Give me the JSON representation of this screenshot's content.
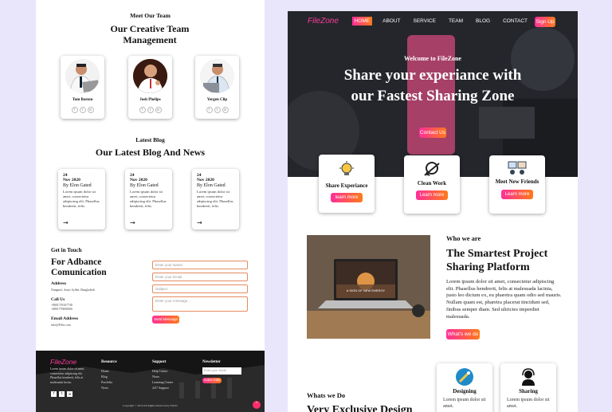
{
  "left": {
    "team_sub": "Meet Our Team",
    "team_title": "Our Creative Team Management",
    "members": [
      {
        "name": "Tom Baston"
      },
      {
        "name": "Josh Phelips"
      },
      {
        "name": "Yergen Clip"
      }
    ],
    "blog_sub": "Latest Blog",
    "blog_title": "Our Latest Blog And News",
    "posts": [
      {
        "day": "24",
        "month": "Nov 2020",
        "by": "By Elon Gated",
        "text": "Lorem ipsum dolor sit amet, consectetur adipiscing elit. Phasellus hendrerit, felis."
      },
      {
        "day": "24",
        "month": "Nov 2020",
        "by": "By Elon Gated",
        "text": "Lorem ipsum dolor sit amet, consectetur adipiscing elit. Phasellus hendrerit, felis."
      },
      {
        "day": "24",
        "month": "Nov 2020",
        "by": "By Elon Gated",
        "text": "Lorem ipsum dolor sit amet, consectetur adipiscing elit. Phasellus hendrerit, felis."
      }
    ],
    "contact": {
      "sub": "Get in Touch",
      "title": "For Adbance Comunication",
      "address_label": "Address",
      "address": "Nungmei, Sonic Sylhet, Bangladesh",
      "call_label": "Call Us",
      "phones": [
        "+8801718167748",
        "+8801770000000"
      ],
      "email_label": "Email Address",
      "email": "info@Filez.com",
      "name_ph": "Enter your Name",
      "email_ph": "Enter your Email",
      "subject_ph": "Subject",
      "message_ph": "Enter your message...",
      "send_label": "Send Message"
    },
    "footer": {
      "brand": "FileZone",
      "about": "Lorem ipsum dolor sit amet, consectetur adipiscing elit. Phasellus hendrerit, felis at malesuada luctus.",
      "resource_title": "Resource",
      "resources": [
        "Home",
        "Blog",
        "Portfolio",
        "News"
      ],
      "support_title": "Support",
      "support": [
        "Help Center",
        "News",
        "Learning Center",
        "24/7 Support"
      ],
      "news_title": "Newsletter",
      "news_ph": "Enter your Email",
      "subscribe": "SUBSCRIBE",
      "copyright": "Copyright © 2016 All Rights Reserved by FileZo"
    }
  },
  "right": {
    "brand": "FileZone",
    "nav": [
      "HOME",
      "ABOUT",
      "SERVICE",
      "TEAM",
      "BLOG",
      "CONTACT"
    ],
    "signup": "Sign Up",
    "welcome": "Welcome to FileZone",
    "hero_line1": "Share your experiance with",
    "hero_line2": "our Fastest Sharing Zone",
    "contact_btn": "Contact Us",
    "features": [
      {
        "title": "Share Experiance",
        "btn": "learn more",
        "icon": "bulb-icon"
      },
      {
        "title": "Clean Work",
        "btn": "Learn more",
        "icon": "broom-icon"
      },
      {
        "title": "Meet New Friends",
        "btn": "Learn more",
        "icon": "friends-icon"
      }
    ],
    "about": {
      "sub": "Who we are",
      "title": "The Smartest Project Sharing Platform",
      "text": "Lorem ipsum dolor sit amet, consectetur adipiscing elit. Phasellus hendrerit, felis at malesuada lacinia, justo leo dictum ex, eu pharetra quam odio sed mauris. Nullam quam est, pharetra placerat tincidunt sed, finibus semper diam. Sed ultricies imperdiet malesuada.",
      "btn": "What's we do",
      "screen_text": "A SIGN OF NEW ENERGY"
    },
    "whatwedo": {
      "sub": "Whats we Do",
      "title": "Very Exclusive Design",
      "cards": [
        {
          "title": "Designing",
          "text": "Lorem ipsum dolor sit amet."
        },
        {
          "title": "Sharing",
          "text": "Lorem ipsum dolor sit amet."
        }
      ]
    }
  },
  "colors": {
    "accent_pink": "#ff2e9a",
    "accent_orange": "#ff7a18",
    "background": "#e9e6fb"
  }
}
